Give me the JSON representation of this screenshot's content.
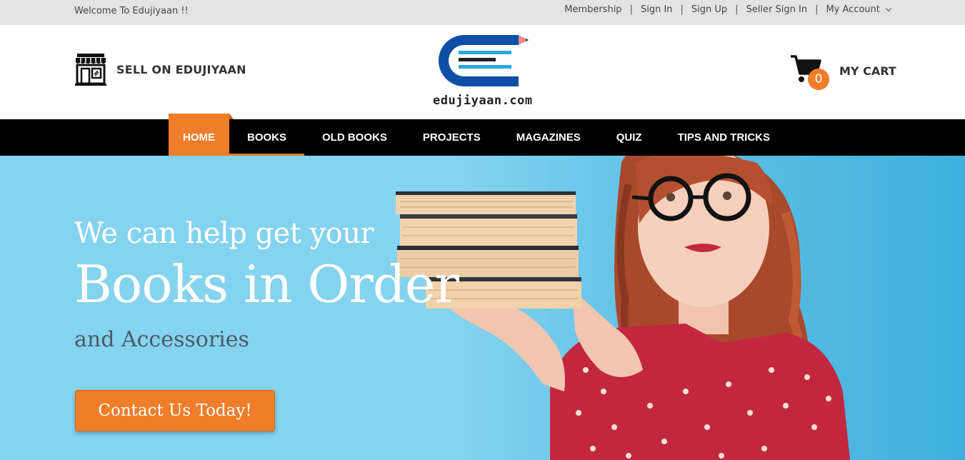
{
  "topbar": {
    "welcome": "Welcome To Edujiyaan !!",
    "links": [
      "Membership",
      "Sign In",
      "Sign Up",
      "Seller Sign In",
      "My Account"
    ]
  },
  "header": {
    "sell_label": "SELL ON EDUJIYAAN",
    "logo_text": "edujiyaan.com",
    "cart_count": "0",
    "cart_label": "MY CART"
  },
  "nav": {
    "items": [
      "HOME",
      "BOOKS",
      "OLD BOOKS",
      "PROJECTS",
      "MAGAZINES",
      "QUIZ",
      "TIPS AND TRICKS"
    ]
  },
  "hero": {
    "line1": "We can help get your",
    "line2": "Books in Order",
    "line3": "and Accessories",
    "cta": "Contact Us Today!"
  },
  "colors": {
    "accent": "#f07d2a",
    "nav_bg": "#000000",
    "topbar_bg": "#e4e4e4",
    "hero_bg": "#84d3ef",
    "logo_blue": "#0d4fa6",
    "logo_cyan": "#29a8e0"
  },
  "icons": {
    "store": "store-icon",
    "cart": "cart-icon",
    "chevron": "chevron-down-icon"
  }
}
